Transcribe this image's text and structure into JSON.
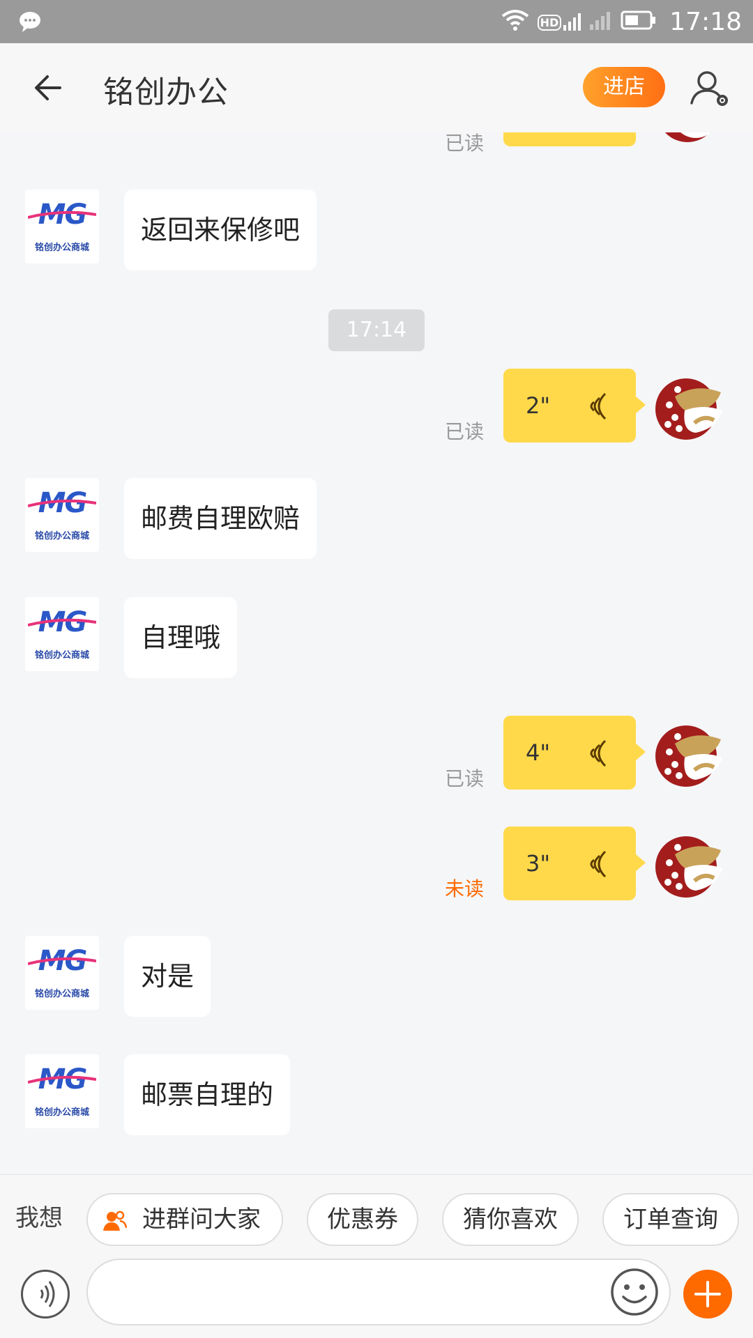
{
  "status_bar": {
    "time": "17:18",
    "network_label": "HD",
    "icons": [
      "message-bubble-icon",
      "wifi-icon",
      "hd-signal-icon",
      "signal-icon",
      "battery-icon"
    ]
  },
  "header": {
    "title": "铭创办公",
    "enter_shop_label": "进店",
    "icons": [
      "back-arrow-icon",
      "user-settings-icon"
    ]
  },
  "shop_avatar": {
    "logo_text": "MG",
    "logo_subtitle": "铭创办公商城"
  },
  "messages": [
    {
      "side": "out",
      "type": "voice",
      "status": "已读",
      "partial": true
    },
    {
      "side": "in",
      "type": "text",
      "text": "返回来保修吧"
    },
    {
      "type": "time",
      "text": "17:14"
    },
    {
      "side": "out",
      "type": "voice",
      "duration": "2\"",
      "status": "已读"
    },
    {
      "side": "in",
      "type": "text",
      "text": "邮费自理欧赔"
    },
    {
      "side": "in",
      "type": "text",
      "text": "自理哦"
    },
    {
      "side": "out",
      "type": "voice",
      "duration": "4\"",
      "status": "已读"
    },
    {
      "side": "out",
      "type": "voice",
      "duration": "3\"",
      "status": "未读"
    },
    {
      "side": "in",
      "type": "text",
      "text": "对是"
    },
    {
      "side": "in",
      "type": "text",
      "text": "邮票自理的"
    }
  ],
  "colors": {
    "accent_orange": "#ff6a00",
    "voice_bubble": "#ffd94a",
    "unread": "#ff6a00",
    "read": "#999999"
  },
  "bottom": {
    "want_label": "我想",
    "chips": [
      "进群问大家",
      "优惠券",
      "猜你喜欢",
      "订单查询"
    ],
    "input_placeholder": "",
    "icons": [
      "group-icon",
      "voice-toggle-icon",
      "emoji-icon",
      "plus-icon"
    ]
  }
}
